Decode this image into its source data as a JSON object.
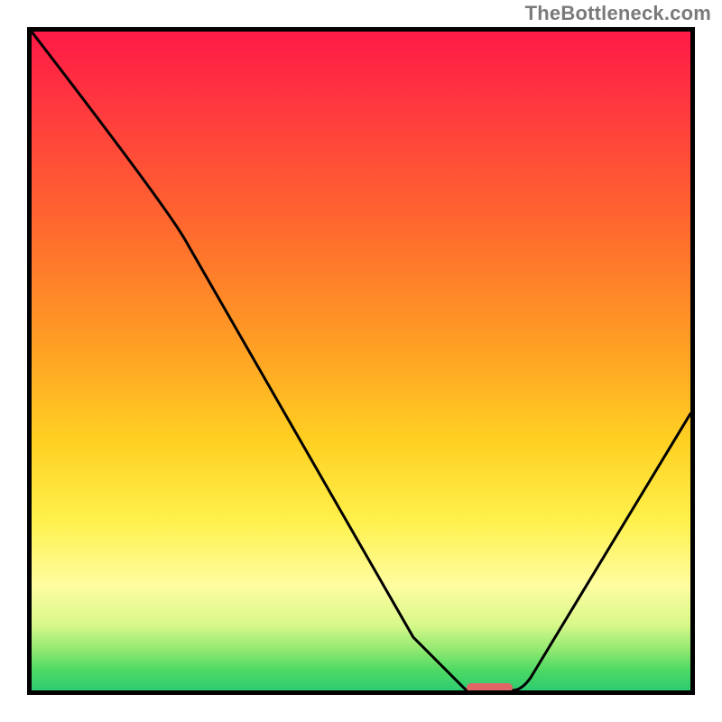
{
  "watermark": "TheBottleneck.com",
  "chart_data": {
    "type": "line",
    "title": "",
    "xlabel": "",
    "ylabel": "",
    "xlim": [
      0,
      100
    ],
    "ylim": [
      0,
      100
    ],
    "grid": false,
    "legend": false,
    "background": "heatmap-gradient",
    "series": [
      {
        "name": "bottleneck-curve",
        "x": [
          0,
          20,
          60,
          66,
          73,
          100
        ],
        "y": [
          100,
          74,
          6,
          0,
          0,
          42
        ],
        "color": "#000000"
      }
    ],
    "marker": {
      "name": "optimal-range",
      "x_start": 66,
      "x_end": 73,
      "y": 0,
      "color": "#e06666"
    }
  }
}
